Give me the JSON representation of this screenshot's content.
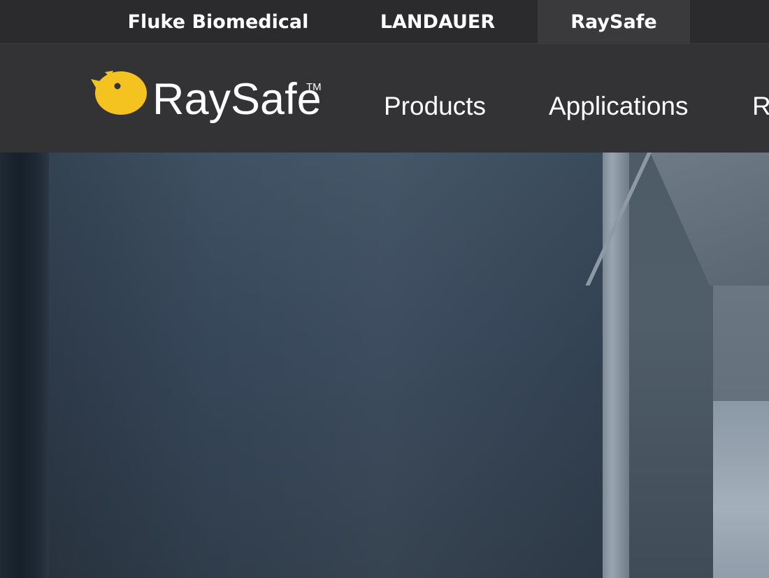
{
  "brand_bar": {
    "tabs": [
      {
        "label": "Fluke Biomedical",
        "active": false
      },
      {
        "label": "LANDAUER",
        "active": false
      },
      {
        "label": "RaySafe",
        "active": true
      }
    ]
  },
  "header": {
    "logo": {
      "text": "RaySafe",
      "tm": "TM",
      "icon": "chick-icon",
      "icon_color": "#f4c31f"
    },
    "nav": [
      {
        "label": "Products"
      },
      {
        "label": "Applications"
      },
      {
        "label": "R"
      }
    ]
  },
  "colors": {
    "brand_bar_bg": "#2b2a2d",
    "active_tab_bg": "#3a393c",
    "header_bg": "#333235",
    "accent_yellow": "#f4c31f"
  }
}
